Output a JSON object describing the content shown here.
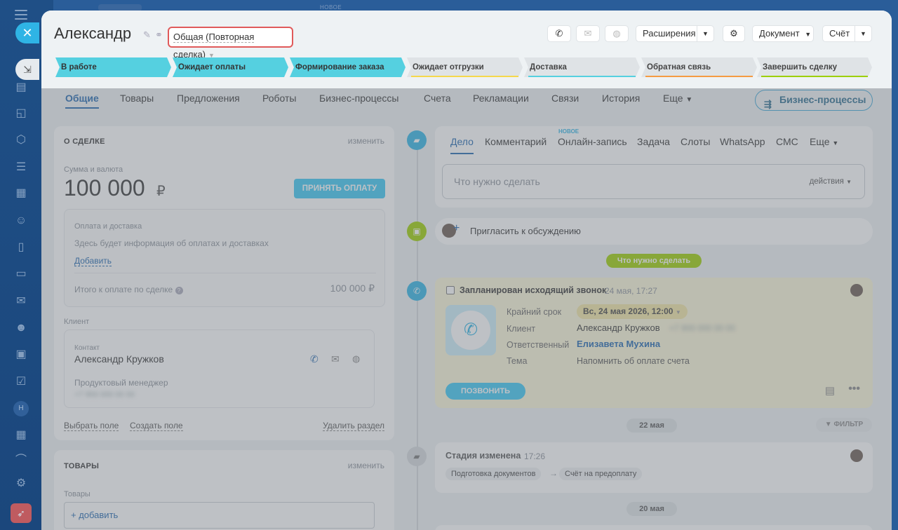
{
  "top": {
    "faint_label": "НОВОЕ"
  },
  "rail": {
    "avatar_letter": "Н"
  },
  "header": {
    "title": "Александр",
    "category": "Общая (Повторная сделка)",
    "extensions_label": "Расширения",
    "document_label": "Документ",
    "invoice_label": "Счёт"
  },
  "stages": [
    {
      "label": "В работе",
      "state": "done"
    },
    {
      "label": "Ожидает оплаты",
      "state": "done"
    },
    {
      "label": "Формирование заказа",
      "state": "done"
    },
    {
      "label": "Ожидает отгрузки",
      "state": "todo",
      "color": "#f5d84c"
    },
    {
      "label": "Доставка",
      "state": "todo",
      "color": "#55d0e0"
    },
    {
      "label": "Обратная связь",
      "state": "todo",
      "color": "#f59b42"
    },
    {
      "label": "Завершить сделку",
      "state": "todo",
      "color": "#9dcf00"
    }
  ],
  "tabs": [
    "Общие",
    "Товары",
    "Предложения",
    "Роботы",
    "Бизнес-процессы",
    "Счета",
    "Рекламации",
    "Связи",
    "История",
    "Еще"
  ],
  "bp_button": "Бизнес-процессы",
  "about": {
    "title": "О СДЕЛКЕ",
    "edit": "изменить",
    "amount_label": "Сумма и валюта",
    "amount": "100 000",
    "currency": "₽",
    "accept_payment": "ПРИНЯТЬ ОПЛАТУ",
    "payment_title": "Оплата и доставка",
    "payment_info": "Здесь будет информация об оплатах и доставках",
    "add": "Добавить",
    "total_label": "Итого к оплате по сделке",
    "total_value": "100 000 ₽",
    "client_label": "Клиент",
    "contact_label": "Контакт",
    "contact_name": "Александр Кружков",
    "contact_position": "Продуктовый менеджер",
    "contact_phone": "+7 900 000 00 00",
    "select_field": "Выбрать поле",
    "create_field": "Создать поле",
    "delete_section": "Удалить раздел"
  },
  "products": {
    "title": "ТОВАРЫ",
    "edit": "изменить",
    "label": "Товары",
    "add": "+ добавить"
  },
  "activity": {
    "tabs": [
      "Дело",
      "Комментарий",
      "Онлайн-запись",
      "Задача",
      "Слоты",
      "WhatsApp",
      "СМС",
      "Еще"
    ],
    "new_badge": "НОВОЕ",
    "placeholder": "Что нужно сделать",
    "actions": "действия"
  },
  "invite": "Пригласить к обсуждению",
  "todo_pill": "Что нужно сделать",
  "call": {
    "title": "Запланирован исходящий звонок",
    "time": "24 мая, 17:27",
    "deadline_label": "Крайний срок",
    "deadline_value": "Вс, 24 мая 2026, 12:00",
    "client_label": "Клиент",
    "client_value": "Александр Кружков",
    "client_phone": "+7 900 000 00 00",
    "responsible_label": "Ответственный",
    "responsible_value": "Елизавета Мухина",
    "topic_label": "Тема",
    "topic_value": "Напомнить об оплате счета",
    "call_button": "ПОЗВОНИТЬ"
  },
  "date1": "22 мая",
  "filter": "ФИЛЬТР",
  "stage_change": {
    "title": "Стадия изменена",
    "time": "17:26",
    "from": "Подготовка документов",
    "arrow": "→",
    "to": "Счёт на предоплату"
  },
  "date2": "20 мая"
}
